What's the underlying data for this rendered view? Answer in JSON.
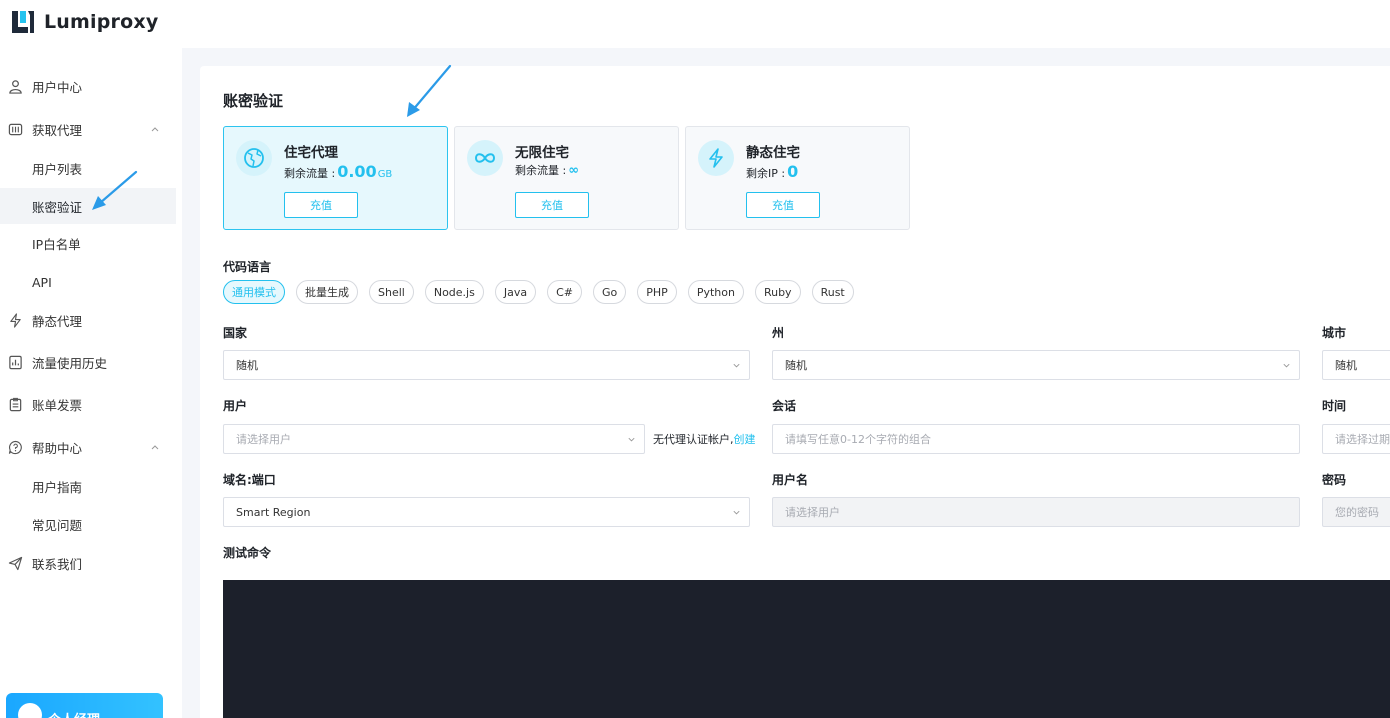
{
  "app": {
    "brand": "Lumiproxy"
  },
  "sidebar": {
    "items": [
      {
        "key": "user-center",
        "label": "用户中心",
        "icon": "user-icon"
      },
      {
        "key": "get-proxy",
        "label": "获取代理",
        "icon": "proxy-icon",
        "expanded": true
      },
      {
        "key": "user-list",
        "label": "用户列表",
        "sub": true
      },
      {
        "key": "account-auth",
        "label": "账密验证",
        "sub": true,
        "active": true
      },
      {
        "key": "ip-whitelist",
        "label": "IP白名单",
        "sub": true
      },
      {
        "key": "api",
        "label": "API",
        "sub": true
      },
      {
        "key": "static-proxy",
        "label": "静态代理",
        "icon": "lightning-icon"
      },
      {
        "key": "traffic-history",
        "label": "流量使用历史",
        "icon": "chart-icon"
      },
      {
        "key": "billing",
        "label": "账单发票",
        "icon": "clipboard-icon"
      },
      {
        "key": "help-center",
        "label": "帮助中心",
        "icon": "help-icon",
        "expanded": true
      },
      {
        "key": "user-guide",
        "label": "用户指南",
        "sub": true
      },
      {
        "key": "faq",
        "label": "常见问题",
        "sub": true
      },
      {
        "key": "contact",
        "label": "联系我们",
        "icon": "send-icon"
      }
    ],
    "manager_label": "个人经理"
  },
  "main": {
    "title": "账密验证",
    "products": [
      {
        "name": "住宅代理",
        "remaining_label": "剩余流量 :",
        "value": "0.00",
        "unit": "GB",
        "button": "充值",
        "active": true,
        "icon": "globe-icon"
      },
      {
        "name": "无限住宅",
        "remaining_label": "剩余流量 :",
        "value": "∞",
        "unit": "",
        "button": "充值",
        "active": false,
        "icon": "infinity-icon"
      },
      {
        "name": "静态住宅",
        "remaining_label": "剩余IP :",
        "value": "0",
        "unit": "",
        "button": "充值",
        "active": false,
        "icon": "lightning-icon"
      }
    ],
    "code_language_label": "代码语言",
    "languages": [
      "通用模式",
      "批量生成",
      "Shell",
      "Node.js",
      "Java",
      "C#",
      "Go",
      "PHP",
      "Python",
      "Ruby",
      "Rust"
    ],
    "active_language": "通用模式",
    "form": {
      "country_label": "国家",
      "country_value": "随机",
      "state_label": "州",
      "state_value": "随机",
      "city_label": "城市",
      "city_value": "随机",
      "user_label": "用户",
      "user_placeholder": "请选择用户",
      "no_user_note": "无代理认证帐户,",
      "create_link": "创建",
      "session_label": "会话",
      "session_placeholder": "请填写任意0-12个字符的组合",
      "time_label": "时间",
      "time_placeholder": "请选择过期",
      "domain_label": "域名:端口",
      "domain_value": "Smart Region",
      "username_label": "用户名",
      "username_placeholder": "请选择用户",
      "password_label": "密码",
      "password_placeholder": "您的密码"
    },
    "test_command_label": "测试命令"
  },
  "colors": {
    "accent": "#23c0ee",
    "terminal": "#1c202b",
    "arrow": "#2b9be8"
  }
}
